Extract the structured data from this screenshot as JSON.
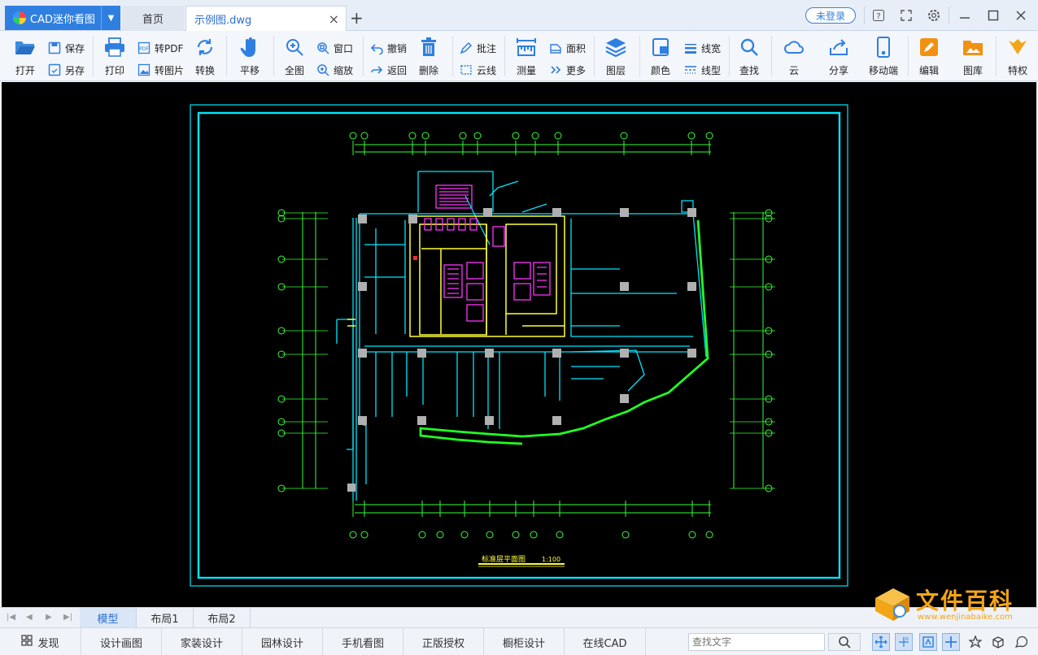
{
  "titlebar": {
    "app_name": "CAD迷你看图",
    "home_tab": "首页",
    "file_tab": "示例图.dwg",
    "login": "未登录"
  },
  "toolbar": {
    "open": "打开",
    "save": "保存",
    "save_as": "另存",
    "print": "打印",
    "to_pdf": "转PDF",
    "to_image": "转图片",
    "convert": "转换",
    "pan": "平移",
    "full_view": "全图",
    "window": "窗口",
    "zoom": "缩放",
    "undo": "撤销",
    "back": "返回",
    "delete": "删除",
    "annotate": "批注",
    "cloud_line": "云线",
    "measure": "测量",
    "area": "面积",
    "more": "更多",
    "layers": "图层",
    "color": "颜色",
    "line_width": "线宽",
    "line_type": "线型",
    "find": "查找",
    "cloud": "云",
    "share": "分享",
    "mobile": "移动端",
    "edit": "编辑",
    "gallery": "图库",
    "vip": "特权"
  },
  "drawing": {
    "title": "标准层平面图",
    "scale": "1:100",
    "colors": {
      "frame": "#00e5ff",
      "grid": "#36ff36",
      "walls": "#00e5ff",
      "stairs": "#ff33ff",
      "core": "#ffff33",
      "columns": "#b0b0b0",
      "curtain_wall": "#22ff22"
    }
  },
  "layouts": {
    "model": "模型",
    "layout1": "布局1",
    "layout2": "布局2"
  },
  "statusbar": {
    "discover": "发现",
    "design_drawing": "设计画图",
    "home_design": "家装设计",
    "garden_design": "园林设计",
    "mobile_view": "手机看图",
    "license": "正版授权",
    "cabinet_design": "橱柜设计",
    "online_cad": "在线CAD",
    "search_placeholder": "查找文字"
  },
  "watermark": {
    "name": "文件百科",
    "url": "www.wenjinabaike.com"
  }
}
